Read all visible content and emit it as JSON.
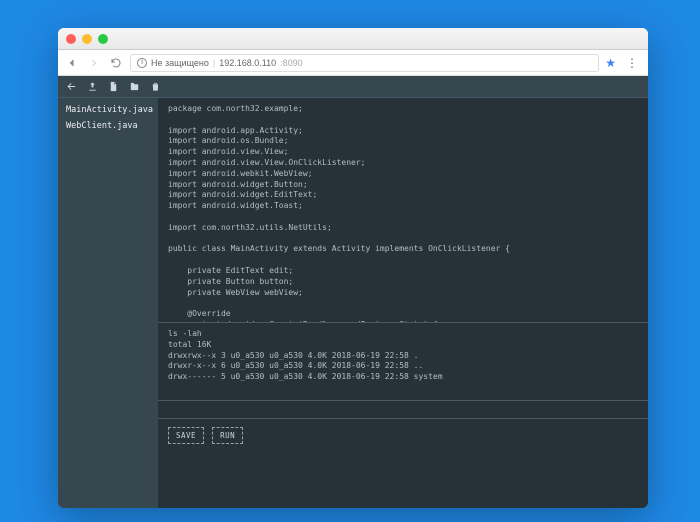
{
  "browser": {
    "security_text": "Не защищено",
    "url_host": "192.168.0.110",
    "url_port": ":8090"
  },
  "sidebar": {
    "files": [
      "MainActivity.java",
      "WebClient.java"
    ]
  },
  "code": "package com.north32.example;\n\nimport android.app.Activity;\nimport android.os.Bundle;\nimport android.view.View;\nimport android.view.View.OnClickListener;\nimport android.webkit.WebView;\nimport android.widget.Button;\nimport android.widget.EditText;\nimport android.widget.Toast;\n\nimport com.north32.utils.NetUtils;\n\npublic class MainActivity extends Activity implements OnClickListener {\n\n    private EditText edit;\n    private Button button;\n    private WebView webView;\n\n    @Override\n    protected void onCreate(Bundle savedInstanceState) {\n        super.onCreate(savedInstanceState);\n        setContentView(R.layout.main);\n        init();\n    }",
  "terminal": "ls -lah\ntotal 16K\ndrwxrwx--x 3 u0_a530 u0_a530 4.0K 2018-06-19 22:58 .\ndrwxr-x--x 6 u0_a530 u0_a530 4.0K 2018-06-19 22:58 ..\ndrwx------ 5 u0_a530 u0_a530 4.0K 2018-06-19 22:58 system",
  "command_input": "",
  "buttons": {
    "save": "SAVE",
    "run": "RUN"
  }
}
